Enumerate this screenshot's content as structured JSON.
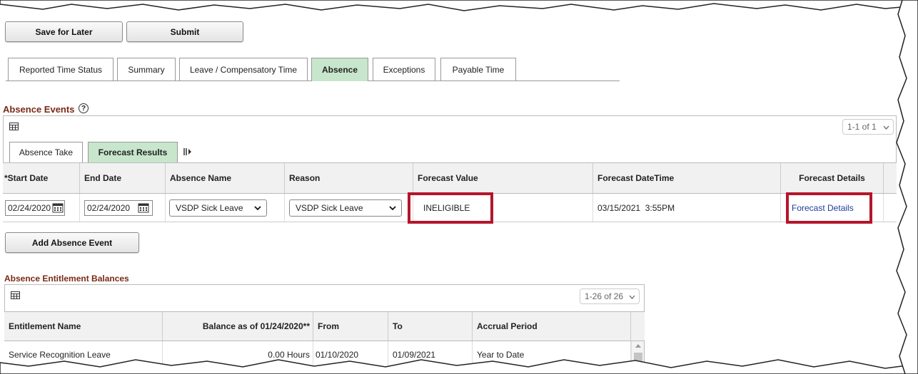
{
  "toolbar": {
    "save_label": "Save for Later",
    "submit_label": "Submit"
  },
  "tabs": [
    {
      "label": "Reported Time Status",
      "active": false
    },
    {
      "label": "Summary",
      "active": false
    },
    {
      "label": "Leave / Compensatory Time",
      "active": false
    },
    {
      "label": "Absence",
      "active": true
    },
    {
      "label": "Exceptions",
      "active": false
    },
    {
      "label": "Payable Time",
      "active": false
    }
  ],
  "absence_events": {
    "title": "Absence Events",
    "help": "?",
    "pager": "1-1 of 1",
    "subtabs": [
      {
        "label": "Absence Take",
        "active": false
      },
      {
        "label": "Forecast Results",
        "active": true
      }
    ],
    "columns": [
      "*Start Date",
      "End Date",
      "Absence Name",
      "Reason",
      "Forecast Value",
      "Forecast DateTime",
      "Forecast Details"
    ],
    "row": {
      "start_date": "02/24/2020",
      "end_date": "02/24/2020",
      "absence_name": "VSDP Sick Leave",
      "reason": "VSDP Sick Leave",
      "forecast_value": "INELIGIBLE",
      "forecast_datetime": "03/15/2021  3:55PM",
      "forecast_details": "Forecast Details"
    },
    "add_button": "Add Absence Event"
  },
  "entitlements": {
    "title": "Absence Entitlement Balances",
    "pager": "1-26 of 26",
    "columns": [
      "Entitlement Name",
      "Balance as of 01/24/2020**",
      "From",
      "To",
      "Accrual Period"
    ],
    "rows": [
      {
        "name": "Service Recognition Leave",
        "balance": "0.00 Hours",
        "from": "01/10/2020",
        "to": "01/09/2021",
        "period": "Year to Date"
      }
    ]
  },
  "colors": {
    "accent_tab": "#c8e6cb",
    "highlight": "#b5152b",
    "section_title": "#7a2a16",
    "link": "#1d3d9e"
  }
}
